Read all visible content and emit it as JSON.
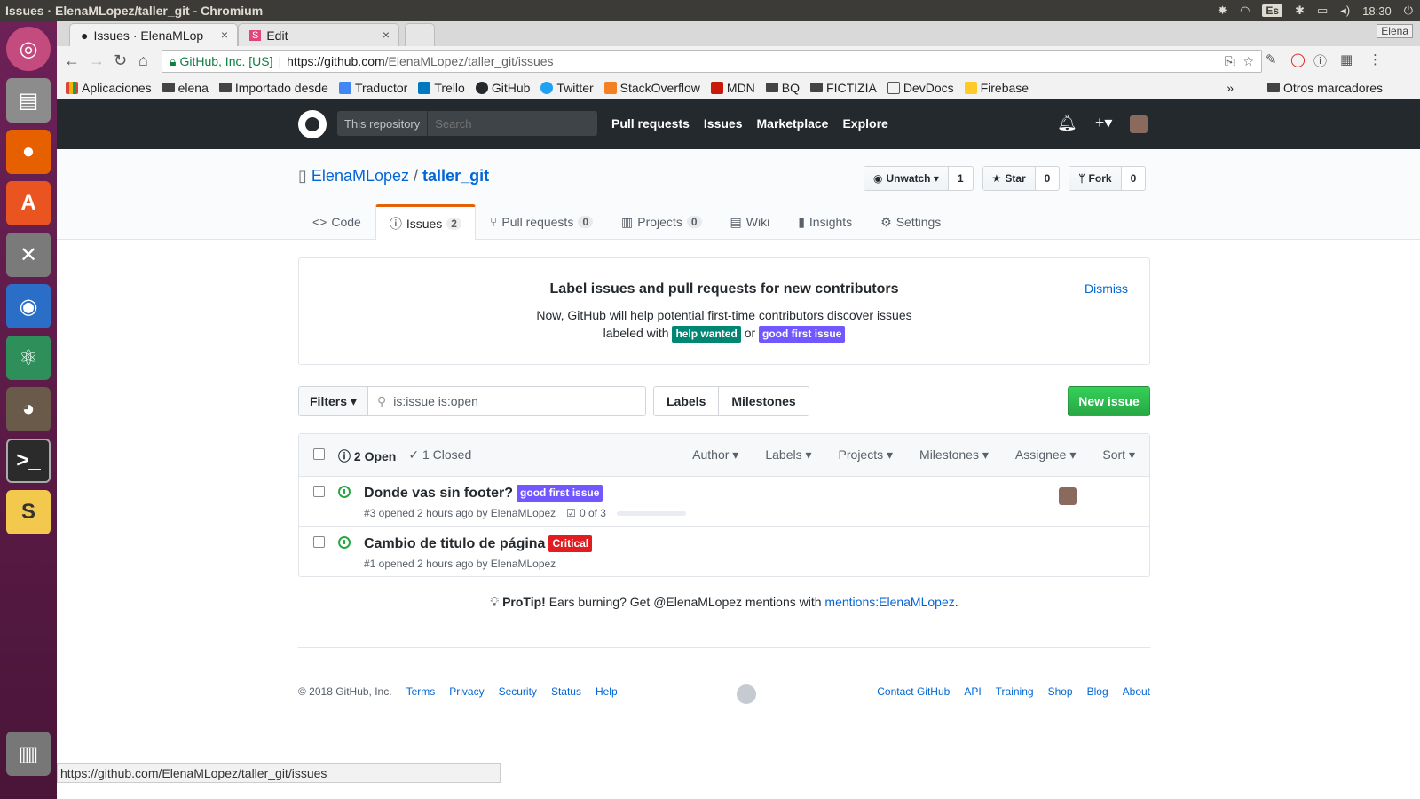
{
  "os": {
    "window_title": "Issues · ElenaMLopez/taller_git - Chromium",
    "lang": "Es",
    "time": "18:30"
  },
  "chrome": {
    "tabs": [
      {
        "label": "Issues · ElenaMLop"
      },
      {
        "label": "Edit"
      }
    ],
    "profile": "Elena",
    "url_security": "GitHub, Inc. [US]",
    "url_host": "https://github.com",
    "url_path": "/ElenaMLopez/taller_git/issues",
    "bookmarks": [
      "Aplicaciones",
      "elena",
      "Importado desde",
      "Traductor",
      "Trello",
      "GitHub",
      "Twitter",
      "StackOverflow",
      "MDN",
      "BQ",
      "FICTIZIA",
      "DevDocs",
      "Firebase"
    ],
    "more_bookmarks": "Otros marcadores",
    "chevron": "»",
    "status_url": "https://github.com/ElenaMLopez/taller_git/issues"
  },
  "github": {
    "scope_label": "This repository",
    "search_placeholder": "Search",
    "nav": [
      "Pull requests",
      "Issues",
      "Marketplace",
      "Explore"
    ],
    "repo_owner": "ElenaMLopez",
    "repo_sep": "/",
    "repo_name": "taller_git",
    "actions": {
      "watch_label": "Unwatch",
      "watch_count": "1",
      "star_label": "Star",
      "star_count": "0",
      "fork_label": "Fork",
      "fork_count": "0"
    },
    "reponav": {
      "code": "Code",
      "issues": "Issues",
      "issues_count": "2",
      "pulls": "Pull requests",
      "pulls_count": "0",
      "projects": "Projects",
      "projects_count": "0",
      "wiki": "Wiki",
      "insights": "Insights",
      "settings": "Settings"
    }
  },
  "banner": {
    "title": "Label issues and pull requests for new contributors",
    "line1": "Now, GitHub will help potential first-time contributors discover issues",
    "line2": "labeled with",
    "or": "or",
    "label_help": "help wanted",
    "label_help_color": "#008672",
    "label_good": "good first issue",
    "label_good_color": "#7057ff",
    "dismiss": "Dismiss"
  },
  "filters": {
    "filters_label": "Filters",
    "query": "is:issue is:open",
    "labels": "Labels",
    "milestones": "Milestones",
    "new_issue": "New issue"
  },
  "issues": {
    "open": "2 Open",
    "closed": "1 Closed",
    "menus": [
      "Author",
      "Labels",
      "Projects",
      "Milestones",
      "Assignee",
      "Sort"
    ],
    "rows": [
      {
        "title": "Donde vas sin footer?",
        "label": "good first issue",
        "label_color": "#7057ff",
        "meta": "#3 opened 2 hours ago by ElenaMLopez",
        "tasks": "0 of 3"
      },
      {
        "title": "Cambio de titulo de página",
        "label": "Critical",
        "label_color": "#e11d21",
        "meta": "#1 opened 2 hours ago by ElenaMLopez"
      }
    ]
  },
  "protip": {
    "bold": "ProTip!",
    "text": " Ears burning? Get @ElenaMLopez mentions with ",
    "link": "mentions:ElenaMLopez",
    "end": "."
  },
  "footer": {
    "copyright": "© 2018 GitHub, Inc.",
    "left_links": [
      "Terms",
      "Privacy",
      "Security",
      "Status",
      "Help"
    ],
    "right_links": [
      "Contact GitHub",
      "API",
      "Training",
      "Shop",
      "Blog",
      "About"
    ]
  }
}
